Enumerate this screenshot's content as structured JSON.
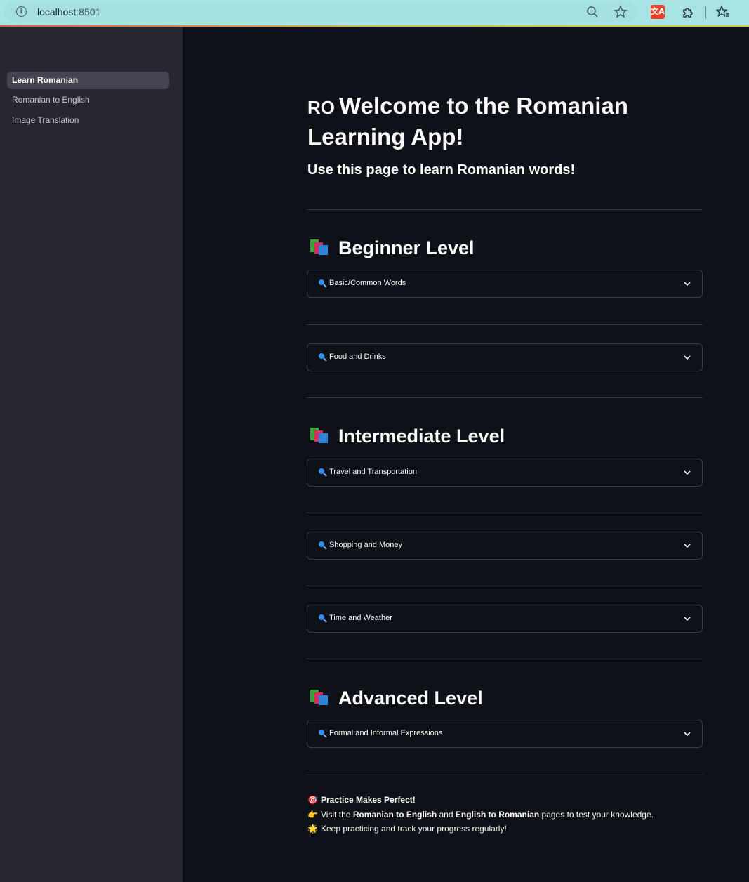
{
  "browser": {
    "url_host": "localhost",
    "url_port": ":8501",
    "ext_badge": "文A"
  },
  "sidebar": {
    "items": [
      {
        "label": "Learn Romanian",
        "active": true
      },
      {
        "label": "Romanian to English",
        "active": false
      },
      {
        "label": "Image Translation",
        "active": false
      }
    ]
  },
  "main": {
    "title_flag": "RO",
    "title": "Welcome to the Romanian Learning App!",
    "subtitle": "Use this page to learn Romanian words!",
    "levels": [
      {
        "heading": "Beginner Level",
        "expanders": [
          "Basic/Common Words",
          "Food and Drinks"
        ]
      },
      {
        "heading": "Intermediate Level",
        "expanders": [
          "Travel and Transportation",
          "Shopping and Money",
          "Time and Weather"
        ]
      },
      {
        "heading": "Advanced Level",
        "expanders": [
          "Formal and Informal Expressions"
        ]
      }
    ],
    "footer": {
      "line1_emoji": "🎯",
      "line1": "Practice Makes Perfect!",
      "line2_emoji": "👉",
      "line2_pre": "Visit the ",
      "line2_b1": "Romanian to English",
      "line2_mid": " and ",
      "line2_b2": "English to Romanian",
      "line2_post": " pages to test your knowledge.",
      "line3_emoji": "🌟",
      "line3": "Keep practicing and track your progress regularly!"
    }
  },
  "colors": {
    "browser_bar": "#a8e4e4",
    "sidebar_bg": "#262730",
    "main_bg": "#0e1117",
    "active_nav": "#43444f",
    "border": "#3b3d45",
    "search_icon": "#2f8ff0"
  }
}
